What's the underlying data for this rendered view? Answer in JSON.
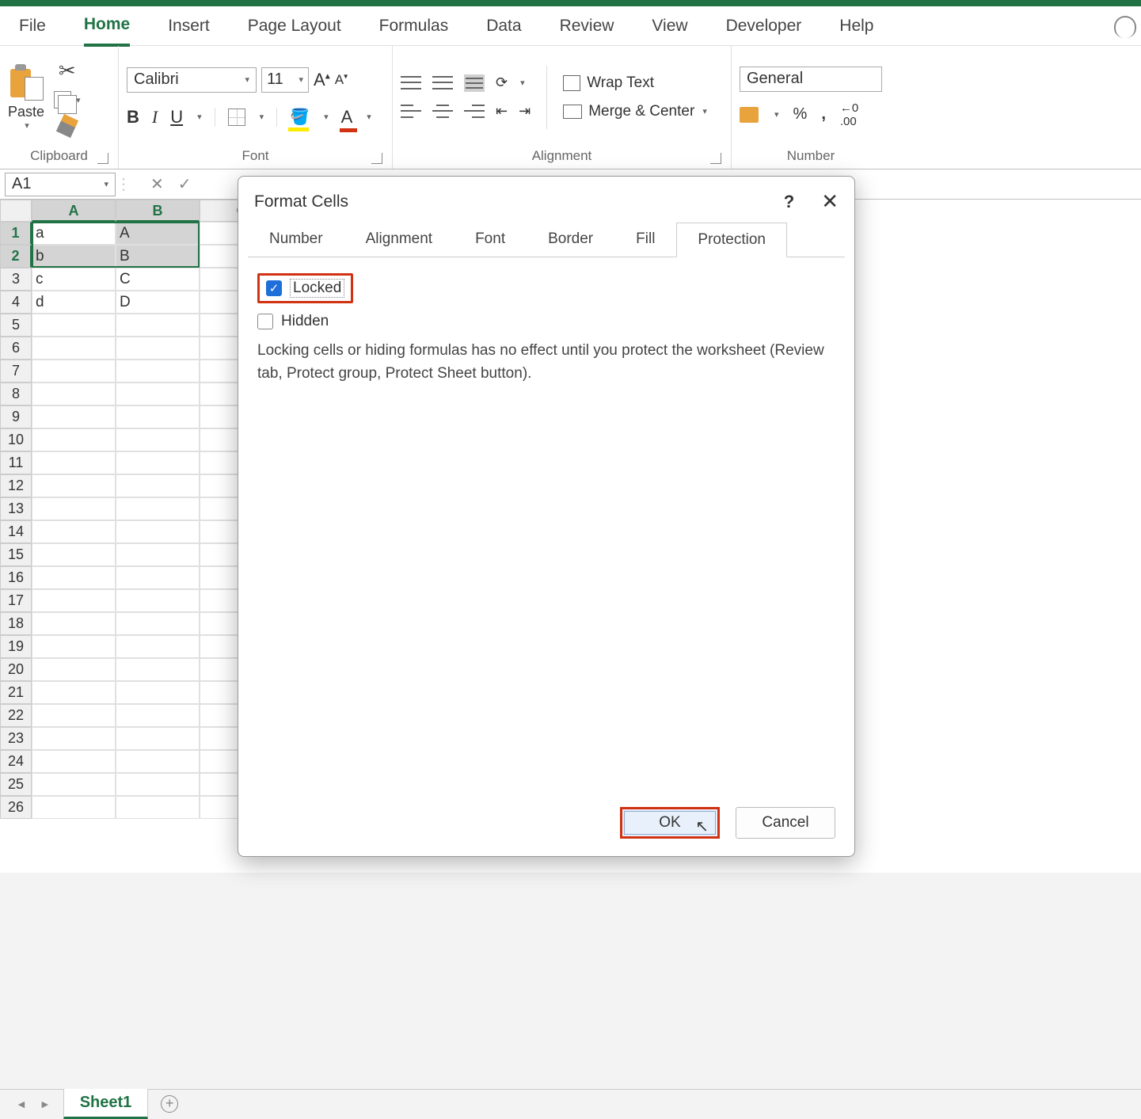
{
  "ribbon": {
    "tabs": [
      "File",
      "Home",
      "Insert",
      "Page Layout",
      "Formulas",
      "Data",
      "Review",
      "View",
      "Developer",
      "Help"
    ],
    "active_tab": "Home",
    "groups": {
      "clipboard": {
        "label": "Clipboard",
        "paste": "Paste"
      },
      "font": {
        "label": "Font",
        "name": "Calibri",
        "size": "11"
      },
      "alignment": {
        "label": "Alignment",
        "wrap": "Wrap Text",
        "merge": "Merge & Center"
      },
      "number": {
        "label": "Number",
        "format": "General"
      }
    }
  },
  "name_box": "A1",
  "columns": [
    "A",
    "B",
    "C"
  ],
  "rows": [
    {
      "n": "1",
      "cells": [
        "a",
        "A",
        ""
      ]
    },
    {
      "n": "2",
      "cells": [
        "b",
        "B",
        ""
      ]
    },
    {
      "n": "3",
      "cells": [
        "c",
        "C",
        ""
      ]
    },
    {
      "n": "4",
      "cells": [
        "d",
        "D",
        ""
      ]
    },
    {
      "n": "5",
      "cells": [
        "",
        "",
        ""
      ]
    },
    {
      "n": "6",
      "cells": [
        "",
        "",
        ""
      ]
    },
    {
      "n": "7",
      "cells": [
        "",
        "",
        ""
      ]
    },
    {
      "n": "8",
      "cells": [
        "",
        "",
        ""
      ]
    },
    {
      "n": "9",
      "cells": [
        "",
        "",
        ""
      ]
    },
    {
      "n": "10",
      "cells": [
        "",
        "",
        ""
      ]
    },
    {
      "n": "11",
      "cells": [
        "",
        "",
        ""
      ]
    },
    {
      "n": "12",
      "cells": [
        "",
        "",
        ""
      ]
    },
    {
      "n": "13",
      "cells": [
        "",
        "",
        ""
      ]
    },
    {
      "n": "14",
      "cells": [
        "",
        "",
        ""
      ]
    },
    {
      "n": "15",
      "cells": [
        "",
        "",
        ""
      ]
    },
    {
      "n": "16",
      "cells": [
        "",
        "",
        ""
      ]
    },
    {
      "n": "17",
      "cells": [
        "",
        "",
        ""
      ]
    },
    {
      "n": "18",
      "cells": [
        "",
        "",
        ""
      ]
    },
    {
      "n": "19",
      "cells": [
        "",
        "",
        ""
      ]
    },
    {
      "n": "20",
      "cells": [
        "",
        "",
        ""
      ]
    },
    {
      "n": "21",
      "cells": [
        "",
        "",
        ""
      ]
    },
    {
      "n": "22",
      "cells": [
        "",
        "",
        ""
      ]
    },
    {
      "n": "23",
      "cells": [
        "",
        "",
        ""
      ]
    },
    {
      "n": "24",
      "cells": [
        "",
        "",
        ""
      ]
    },
    {
      "n": "25",
      "cells": [
        "",
        "",
        ""
      ]
    },
    {
      "n": "26",
      "cells": [
        "",
        "",
        ""
      ]
    }
  ],
  "sheet_tab": "Sheet1",
  "dialog": {
    "title": "Format Cells",
    "tabs": [
      "Number",
      "Alignment",
      "Font",
      "Border",
      "Fill",
      "Protection"
    ],
    "active_tab": "Protection",
    "locked_label": "Locked",
    "hidden_label": "Hidden",
    "description": "Locking cells or hiding formulas has no effect until you protect the worksheet (Review tab, Protect group, Protect Sheet button).",
    "ok": "OK",
    "cancel": "Cancel",
    "help": "?",
    "close": "✕"
  }
}
